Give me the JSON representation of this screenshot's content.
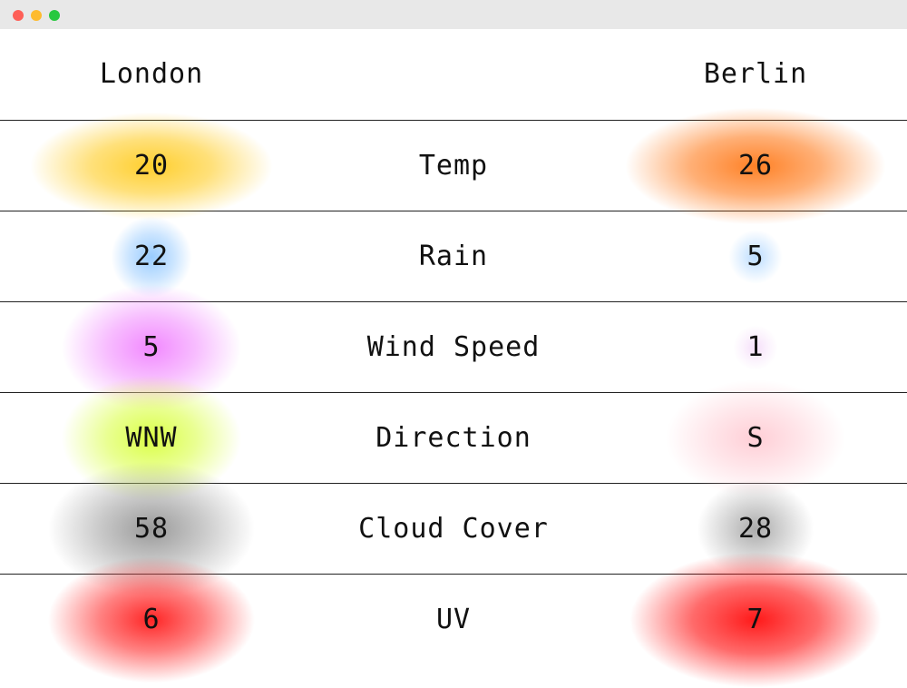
{
  "window": {
    "controls": [
      "close",
      "minimize",
      "zoom"
    ]
  },
  "colors": {
    "close": "#fe5f57",
    "minimize": "#febb2e",
    "zoom": "#28c840",
    "temp_london": "#ffcc22",
    "temp_berlin": "#ff7a1a",
    "rain": "#8ec6ff",
    "wind_london": "#f07cff",
    "wind_berlin": "#f3d6f8",
    "dir_london": "#d8ff3a",
    "dir_berlin": "#ffc6cf",
    "cloud": "#888888",
    "uv": "#ff1a1a"
  },
  "header": {
    "left_city": "London",
    "right_city": "Berlin"
  },
  "rows": [
    {
      "label": "Temp",
      "london": "20",
      "berlin": "26"
    },
    {
      "label": "Rain",
      "london": "22",
      "berlin": "5"
    },
    {
      "label": "Wind Speed",
      "london": "5",
      "berlin": "1"
    },
    {
      "label": "Direction",
      "london": "WNW",
      "berlin": "S"
    },
    {
      "label": "Cloud Cover",
      "london": "58",
      "berlin": "28"
    },
    {
      "label": "UV",
      "london": "6",
      "berlin": "7"
    }
  ]
}
